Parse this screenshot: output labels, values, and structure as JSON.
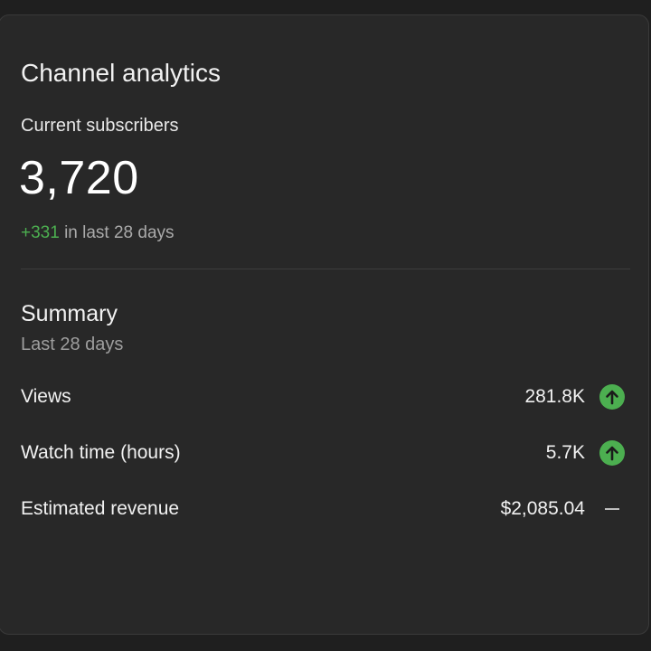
{
  "card": {
    "title": "Channel analytics"
  },
  "subscribers": {
    "label": "Current subscribers",
    "value": "3,720",
    "change_value": "+331",
    "change_text": " in last 28 days"
  },
  "summary": {
    "title": "Summary",
    "period": "Last 28 days",
    "metrics": [
      {
        "label": "Views",
        "value": "281.8K",
        "trend": "up",
        "icon": "arrow-up-circle-icon"
      },
      {
        "label": "Watch time (hours)",
        "value": "5.7K",
        "trend": "up",
        "icon": "arrow-up-circle-icon"
      },
      {
        "label": "Estimated revenue",
        "value": "$2,085.04",
        "trend": "flat",
        "icon": "dash-icon"
      }
    ]
  },
  "colors": {
    "positive": "#4caf50",
    "text_primary": "#f1f1f1",
    "text_secondary": "#9e9e9e",
    "card_bg": "#282828"
  }
}
